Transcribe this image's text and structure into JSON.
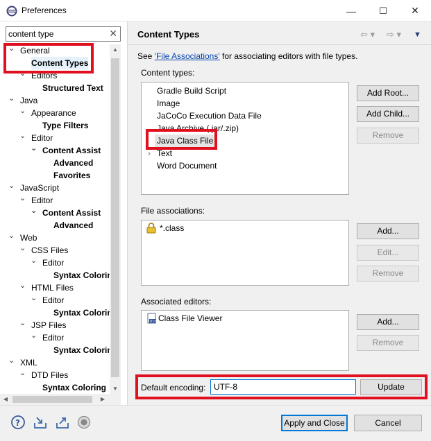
{
  "window": {
    "title": "Preferences",
    "controls": [
      "—",
      "☐",
      "✕"
    ]
  },
  "sidebar": {
    "filter_value": "content type",
    "clear_glyph": "✕",
    "tree": [
      {
        "label": "General",
        "level": 0,
        "expanded": true
      },
      {
        "label": "Content Types",
        "level": 1,
        "bold": true,
        "selected": true
      },
      {
        "label": "Editors",
        "level": 1,
        "expanded": true
      },
      {
        "label": "Structured Text",
        "level": 2,
        "bold": true
      },
      {
        "label": "Java",
        "level": 0,
        "expanded": true
      },
      {
        "label": "Appearance",
        "level": 1,
        "expanded": true
      },
      {
        "label": "Type Filters",
        "level": 2,
        "bold": true
      },
      {
        "label": "Editor",
        "level": 1,
        "expanded": true
      },
      {
        "label": "Content Assist",
        "level": 2,
        "bold": true,
        "expanded": true
      },
      {
        "label": "Advanced",
        "level": 3,
        "bold": true
      },
      {
        "label": "Favorites",
        "level": 3,
        "bold": true
      },
      {
        "label": "JavaScript",
        "level": 0,
        "expanded": true
      },
      {
        "label": "Editor",
        "level": 1,
        "expanded": true
      },
      {
        "label": "Content Assist",
        "level": 2,
        "bold": true,
        "expanded": true
      },
      {
        "label": "Advanced",
        "level": 3,
        "bold": true
      },
      {
        "label": "Web",
        "level": 0,
        "expanded": true
      },
      {
        "label": "CSS Files",
        "level": 1,
        "expanded": true
      },
      {
        "label": "Editor",
        "level": 2,
        "expanded": true
      },
      {
        "label": "Syntax Coloring",
        "level": 3,
        "bold": true
      },
      {
        "label": "HTML Files",
        "level": 1,
        "expanded": true
      },
      {
        "label": "Editor",
        "level": 2,
        "expanded": true
      },
      {
        "label": "Syntax Coloring",
        "level": 3,
        "bold": true
      },
      {
        "label": "JSP Files",
        "level": 1,
        "expanded": true
      },
      {
        "label": "Editor",
        "level": 2,
        "expanded": true
      },
      {
        "label": "Syntax Coloring",
        "level": 3,
        "bold": true
      },
      {
        "label": "XML",
        "level": 0,
        "expanded": true
      },
      {
        "label": "DTD Files",
        "level": 1,
        "expanded": true
      },
      {
        "label": "Syntax Coloring",
        "level": 2,
        "bold": true
      }
    ]
  },
  "page": {
    "title": "Content Types",
    "see_prefix": "See ",
    "see_link": "'File Associations'",
    "see_suffix": " for associating editors with file types.",
    "content_types_label": "Content types:",
    "content_types": [
      {
        "label": "Gradle Build Script"
      },
      {
        "label": "Image"
      },
      {
        "label": "JaCoCo Execution Data File"
      },
      {
        "label": "Java Archive (.jar/.zip)"
      },
      {
        "label": "Java Class File",
        "selected": true
      },
      {
        "label": "Text",
        "expandable": true
      },
      {
        "label": "Word Document"
      }
    ],
    "add_root": "Add Root...",
    "add_child": "Add Child...",
    "remove_types": "Remove",
    "file_assoc_label": "File associations:",
    "file_associations": [
      "*.class"
    ],
    "add_assoc": "Add...",
    "edit_assoc": "Edit...",
    "remove_assoc": "Remove",
    "assoc_editors_label": "Associated editors:",
    "associated_editors": [
      "Class File Viewer"
    ],
    "add_editor": "Add...",
    "remove_editor": "Remove",
    "encoding_label": "Default encoding:",
    "encoding_value": "UTF-8",
    "update": "Update"
  },
  "footer": {
    "apply_close": "Apply and Close",
    "cancel": "Cancel"
  },
  "colors": {
    "highlight": "#e01020",
    "link": "#0645ad",
    "focus": "#0078d7"
  }
}
